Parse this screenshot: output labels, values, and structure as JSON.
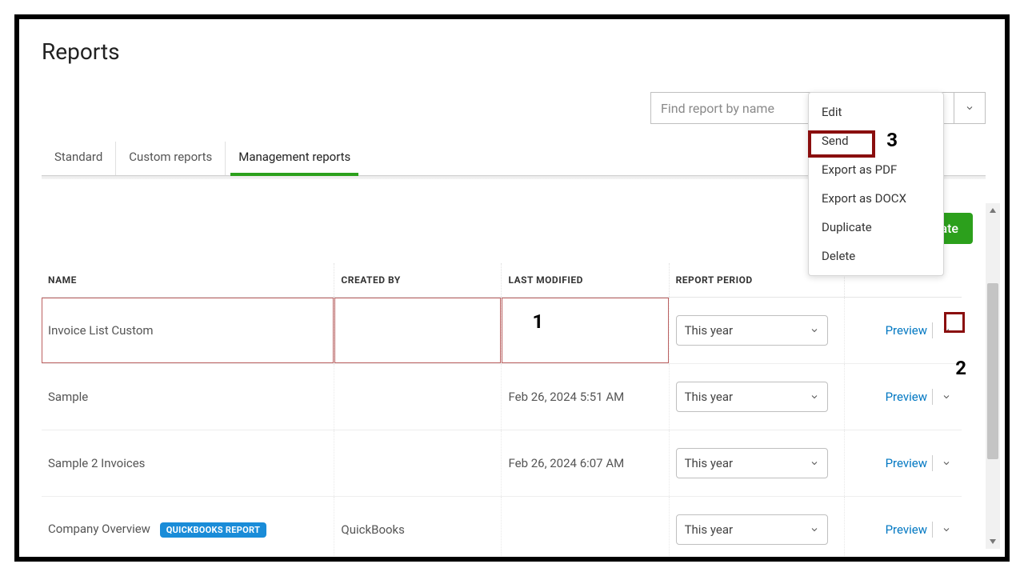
{
  "header": {
    "title": "Reports"
  },
  "search": {
    "placeholder": "Find report by name"
  },
  "tabs": [
    "Standard",
    "Custom reports",
    "Management reports"
  ],
  "toolbar": {
    "create_label": "Create"
  },
  "table": {
    "headers": {
      "name": "NAME",
      "created_by": "CREATED BY",
      "last_modified": "LAST MODIFIED",
      "report_period": "REPORT PERIOD"
    },
    "rows": [
      {
        "name": "Invoice List Custom",
        "created_by": "",
        "last_modified": "",
        "period": "This year"
      },
      {
        "name": "Sample",
        "created_by": "",
        "last_modified": "Feb 26, 2024 5:51 AM",
        "period": "This year"
      },
      {
        "name": "Sample 2 Invoices",
        "created_by": "",
        "last_modified": "Feb 26, 2024 6:07 AM",
        "period": "This year"
      },
      {
        "name": "Company Overview",
        "badge": "QUICKBOOKS REPORT",
        "created_by": "QuickBooks",
        "last_modified": "",
        "period": "This year"
      }
    ]
  },
  "actions": {
    "preview": "Preview"
  },
  "menu": {
    "edit": "Edit",
    "send": "Send",
    "export_pdf": "Export as PDF",
    "export_docx": "Export as DOCX",
    "duplicate": "Duplicate",
    "delete": "Delete"
  },
  "annotations": {
    "one": "1",
    "two": "2",
    "three": "3"
  }
}
